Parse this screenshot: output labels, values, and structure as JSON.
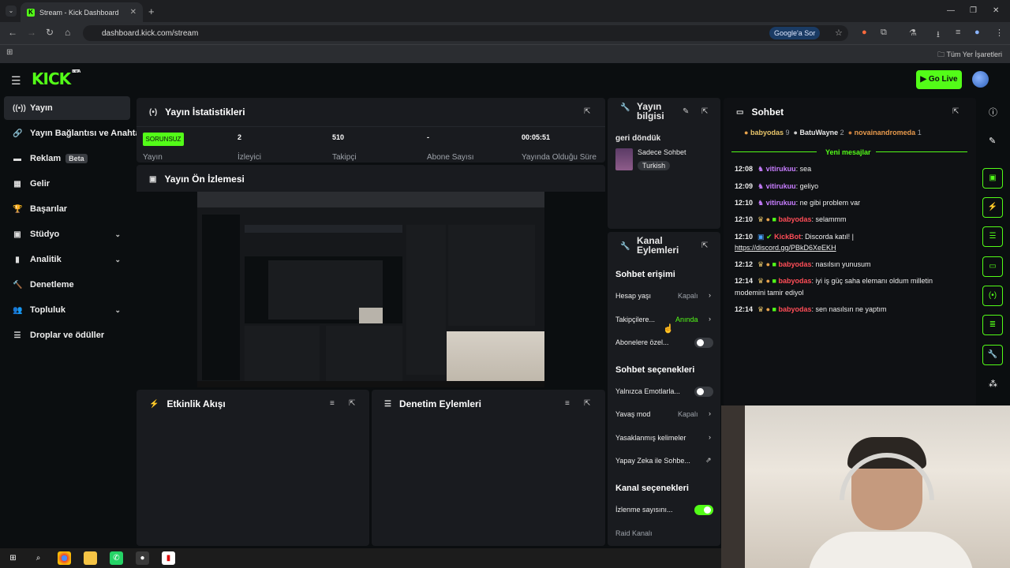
{
  "browser": {
    "tab_title": "Stream - Kick Dashboard",
    "url": "dashboard.kick.com/stream",
    "google_pill": "Google'a Sor",
    "bookmarks_label": "Tüm Yer İşaretleri"
  },
  "header": {
    "logo": "KICK",
    "logo_tag": "BETA",
    "go_live": "Go Live"
  },
  "sidebar": {
    "items": [
      {
        "label": "Yayın",
        "icon": "broadcast-icon"
      },
      {
        "label": "Yayın Bağlantısı ve Anahtar",
        "icon": "link-icon"
      },
      {
        "label": "Reklam",
        "icon": "ad-icon",
        "badge": "Beta"
      },
      {
        "label": "Gelir",
        "icon": "revenue-icon"
      },
      {
        "label": "Başarılar",
        "icon": "trophy-icon"
      },
      {
        "label": "Stüdyo",
        "icon": "studio-icon"
      },
      {
        "label": "Analitik",
        "icon": "analytics-icon"
      },
      {
        "label": "Denetleme",
        "icon": "hammer-icon"
      },
      {
        "label": "Topluluk",
        "icon": "community-icon"
      },
      {
        "label": "Droplar ve ödüller",
        "icon": "gift-icon"
      }
    ]
  },
  "stats": {
    "title": "Yayın İstatistikleri",
    "status_badge": "SORUNSUZ",
    "status_label": "Yayın",
    "viewers_value": "2",
    "viewers_label": "İzleyici",
    "followers_value": "510",
    "followers_label": "Takipçi",
    "subs_value": "-",
    "subs_label": "Abone Sayısı",
    "uptime_value": "00:05:51",
    "uptime_label": "Yayında Olduğu Süre"
  },
  "preview": {
    "title": "Yayın Ön İzlemesi"
  },
  "activity": {
    "title": "Etkinlik Akışı"
  },
  "moderation": {
    "title": "Denetim Eylemleri"
  },
  "stream_info": {
    "title": "Yayın bilgisi",
    "stream_title": "geri döndük",
    "category": "Sadece Sohbet",
    "tag": "Turkish"
  },
  "channel_actions": {
    "title": "Kanal Eylemleri",
    "section_access": "Sohbet erişimi",
    "account_age_label": "Hesap yaşı",
    "account_age_value": "Kapalı",
    "followers_label": "Takipçilere...",
    "followers_value": "Anında",
    "subscribers_label": "Abonelere özel...",
    "section_chat": "Sohbet seçenekleri",
    "emote_only_label": "Yalnızca Emotlarla...",
    "slow_mode_label": "Yavaş mod",
    "slow_mode_value": "Kapalı",
    "banned_words_label": "Yasaklanmış kelimeler",
    "ai_label": "Yapay Zeka ile Sohbe...",
    "section_channel": "Kanal seçenekleri",
    "viewer_count_label": "İzlenme sayısını...",
    "raid_label": "Raid Kanalı"
  },
  "chat": {
    "title": "Sohbet",
    "top": [
      {
        "name": "babyodas",
        "count": "9"
      },
      {
        "name": "BatuWayne",
        "count": "2"
      },
      {
        "name": "novainandromeda",
        "count": "1"
      }
    ],
    "new_messages": "Yeni mesajlar",
    "messages": [
      {
        "time": "12:08",
        "user": "vitirukuu",
        "text": ": sea",
        "cls": "u-purple"
      },
      {
        "time": "12:09",
        "user": "vitirukuu",
        "text": ": geliyo",
        "cls": "u-purple"
      },
      {
        "time": "12:10",
        "user": "vitirukuu",
        "text": ": ne gibi problem var",
        "cls": "u-purple"
      },
      {
        "time": "12:10",
        "user": "babyodas",
        "text": ": selammm",
        "cls": "u-red"
      },
      {
        "time": "12:10",
        "user": "KickBot",
        "text": ": Discorda katıl! |",
        "cls": "u-red",
        "link": "https://discord.gg/PBkD6XeEKH"
      },
      {
        "time": "12:12",
        "user": "babyodas",
        "text": ": nasılsın yunusum",
        "cls": "u-red"
      },
      {
        "time": "12:14",
        "user": "babyodas",
        "text": ": iyi iş güç saha elemanı oldum milletin",
        "cls": "u-red",
        "cont": "modemini tamir ediyol"
      },
      {
        "time": "12:14",
        "user": "babyodas",
        "text": ": sen nasılsın ne yaptım",
        "cls": "u-red"
      }
    ]
  },
  "colors": {
    "accent": "#53fc18",
    "panel": "#191b1f",
    "bg": "#0b0e10"
  }
}
